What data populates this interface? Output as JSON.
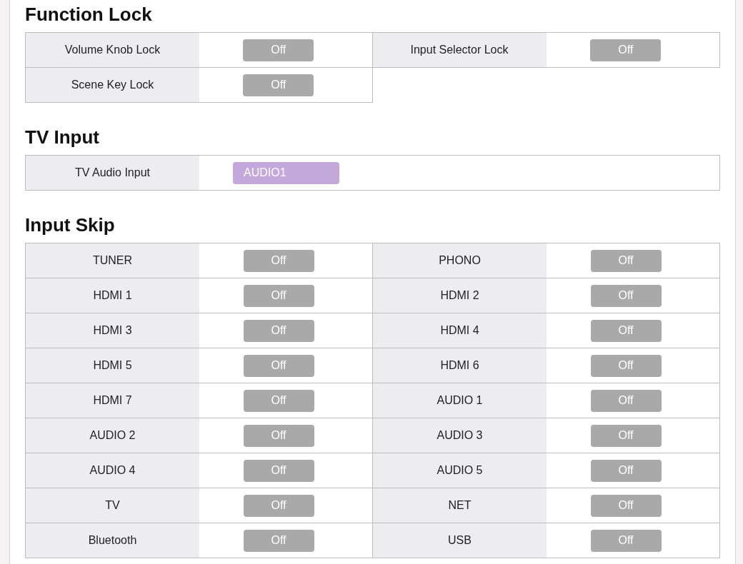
{
  "sections": [
    {
      "title": "Function Lock",
      "kind": "pairs",
      "settings": [
        {
          "kind": "toggle",
          "label": "Volume Knob Lock",
          "value": "Off",
          "on": false
        },
        {
          "kind": "toggle",
          "label": "Input Selector Lock",
          "value": "Off",
          "on": false
        },
        {
          "kind": "toggle",
          "label": "Scene Key Lock",
          "value": "Off",
          "on": false
        }
      ]
    },
    {
      "title": "TV Input",
      "kind": "wide",
      "settings": [
        {
          "kind": "select",
          "label": "TV Audio Input",
          "value": "AUDIO1"
        }
      ]
    },
    {
      "title": "Input Skip",
      "kind": "pairs",
      "settings": [
        {
          "kind": "toggle",
          "label": "TUNER",
          "value": "Off",
          "on": false
        },
        {
          "kind": "toggle",
          "label": "PHONO",
          "value": "Off",
          "on": false
        },
        {
          "kind": "toggle",
          "label": "HDMI 1",
          "value": "Off",
          "on": false
        },
        {
          "kind": "toggle",
          "label": "HDMI 2",
          "value": "Off",
          "on": false
        },
        {
          "kind": "toggle",
          "label": "HDMI 3",
          "value": "Off",
          "on": false
        },
        {
          "kind": "toggle",
          "label": "HDMI 4",
          "value": "Off",
          "on": false
        },
        {
          "kind": "toggle",
          "label": "HDMI 5",
          "value": "Off",
          "on": false
        },
        {
          "kind": "toggle",
          "label": "HDMI 6",
          "value": "Off",
          "on": false
        },
        {
          "kind": "toggle",
          "label": "HDMI 7",
          "value": "Off",
          "on": false
        },
        {
          "kind": "toggle",
          "label": "AUDIO 1",
          "value": "Off",
          "on": false
        },
        {
          "kind": "toggle",
          "label": "AUDIO 2",
          "value": "Off",
          "on": false
        },
        {
          "kind": "toggle",
          "label": "AUDIO 3",
          "value": "Off",
          "on": false
        },
        {
          "kind": "toggle",
          "label": "AUDIO 4",
          "value": "Off",
          "on": false
        },
        {
          "kind": "toggle",
          "label": "AUDIO 5",
          "value": "Off",
          "on": false
        },
        {
          "kind": "toggle",
          "label": "TV",
          "value": "Off",
          "on": false
        },
        {
          "kind": "toggle",
          "label": "NET",
          "value": "Off",
          "on": false
        },
        {
          "kind": "toggle",
          "label": "Bluetooth",
          "value": "Off",
          "on": false
        },
        {
          "kind": "toggle",
          "label": "USB",
          "value": "Off",
          "on": false
        }
      ]
    }
  ]
}
